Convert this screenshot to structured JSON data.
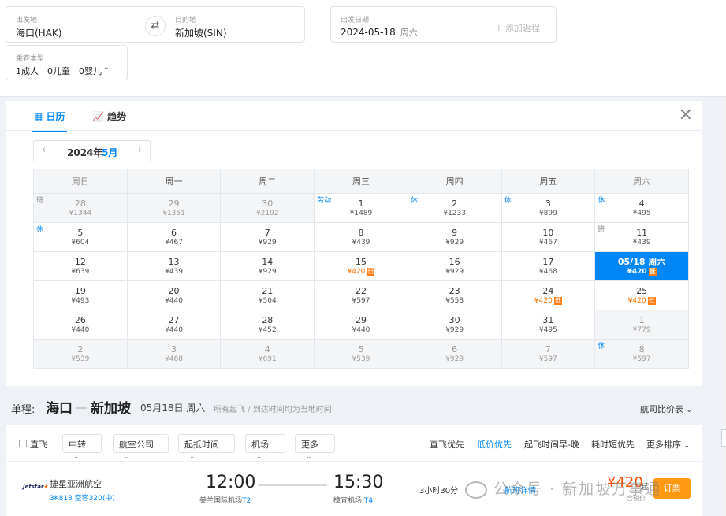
{
  "search": {
    "from_label": "出发地",
    "from_value": "海口(HAK)",
    "to_label": "目的地",
    "to_value": "新加坡(SIN)",
    "date_label": "出发日期",
    "date_value": "2024-05-18",
    "date_weekday": "周六",
    "add_trip": "+ 添加返程",
    "pax_label": "乘客类型",
    "pax_value": "1成人　0儿童　0婴儿",
    "swap_icon": "⇄",
    "chevron": "⌄"
  },
  "calendar": {
    "tab_calendar": "日历",
    "tab_trend": "趋势",
    "year": "2024年",
    "month": "5月",
    "weekdays": [
      "周日",
      "周一",
      "周二",
      "周三",
      "周四",
      "周五",
      "周六"
    ],
    "rows": [
      [
        {
          "d": "28",
          "p": "¥1344",
          "past": true,
          "tag": "班",
          "tagType": "work"
        },
        {
          "d": "29",
          "p": "¥1351",
          "past": true
        },
        {
          "d": "30",
          "p": "¥2192",
          "past": true
        },
        {
          "d": "1",
          "p": "¥1489",
          "tag": "劳动",
          "tagType": "holi"
        },
        {
          "d": "2",
          "p": "¥1233",
          "tag": "休",
          "tagType": "rest"
        },
        {
          "d": "3",
          "p": "¥899",
          "tag": "休",
          "tagType": "rest"
        },
        {
          "d": "4",
          "p": "¥495",
          "tag": "休",
          "tagType": "rest"
        }
      ],
      [
        {
          "d": "5",
          "p": "¥604",
          "tag": "休",
          "tagType": "rest"
        },
        {
          "d": "6",
          "p": "¥467"
        },
        {
          "d": "7",
          "p": "¥929"
        },
        {
          "d": "8",
          "p": "¥439"
        },
        {
          "d": "9",
          "p": "¥929"
        },
        {
          "d": "10",
          "p": "¥467"
        },
        {
          "d": "11",
          "p": "¥439",
          "tag": "班",
          "tagType": "work"
        }
      ],
      [
        {
          "d": "12",
          "p": "¥639"
        },
        {
          "d": "13",
          "p": "¥439"
        },
        {
          "d": "14",
          "p": "¥929"
        },
        {
          "d": "15",
          "p": "¥420",
          "low": true
        },
        {
          "d": "16",
          "p": "¥929"
        },
        {
          "d": "17",
          "p": "¥468"
        },
        {
          "d": "05/18 周六",
          "p": "¥420",
          "low": true,
          "sel": true
        }
      ],
      [
        {
          "d": "19",
          "p": "¥493"
        },
        {
          "d": "20",
          "p": "¥440"
        },
        {
          "d": "21",
          "p": "¥504"
        },
        {
          "d": "22",
          "p": "¥597"
        },
        {
          "d": "23",
          "p": "¥558"
        },
        {
          "d": "24",
          "p": "¥420",
          "low": true
        },
        {
          "d": "25",
          "p": "¥420",
          "low": true
        }
      ],
      [
        {
          "d": "26",
          "p": "¥440"
        },
        {
          "d": "27",
          "p": "¥440"
        },
        {
          "d": "28",
          "p": "¥452"
        },
        {
          "d": "29",
          "p": "¥440"
        },
        {
          "d": "30",
          "p": "¥929"
        },
        {
          "d": "31",
          "p": "¥495"
        },
        {
          "d": "1",
          "p": "¥779",
          "past": true
        }
      ],
      [
        {
          "d": "2",
          "p": "¥539",
          "past": true
        },
        {
          "d": "3",
          "p": "¥468",
          "past": true
        },
        {
          "d": "4",
          "p": "¥691",
          "past": true
        },
        {
          "d": "5",
          "p": "¥539",
          "past": true
        },
        {
          "d": "6",
          "p": "¥929",
          "past": true
        },
        {
          "d": "7",
          "p": "¥597",
          "past": true
        },
        {
          "d": "8",
          "p": "¥597",
          "past": true,
          "tag": "休",
          "tagType": "rest"
        }
      ]
    ],
    "low_badge": "低"
  },
  "result": {
    "trip_label": "单程:",
    "from_city": "海口",
    "to_city": "新加坡",
    "date": "05月18日 周六",
    "note": "所有起飞 / 到达时间均为当地时间",
    "compare": "航司比价表"
  },
  "filters": {
    "direct": "直飞",
    "transfer": "中转",
    "airline": "航空公司",
    "deptime": "起抵时间",
    "airport": "机场",
    "more": "更多",
    "sort_direct": "直飞优先",
    "sort_low": "低价优先",
    "sort_time": "起飞时间早-晚",
    "sort_short": "耗时短优先",
    "sort_more": "更多排序"
  },
  "flight": {
    "logo": "Jetstar",
    "airline": "捷星亚洲航空",
    "number": "3K818 空客320(中)",
    "dep_time": "12:00",
    "arr_time": "15:30",
    "dep_airport": "美兰国际机场",
    "dep_term": "T2",
    "arr_airport": "樟宜机场",
    "arr_term": "T4",
    "duration": "3小时30分",
    "detail": "航班详情",
    "price": "¥420",
    "price_suffix": "起",
    "tax": "含税价",
    "book": "订票"
  },
  "watermark": "公众号 · 新加坡万事通"
}
